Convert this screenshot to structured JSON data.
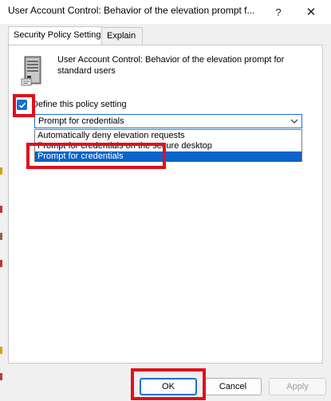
{
  "window": {
    "title": "User Account Control: Behavior of the elevation prompt f...",
    "help_glyph": "?",
    "close_glyph": "✕"
  },
  "tabs": [
    {
      "label": "Security Policy Setting",
      "active": true
    },
    {
      "label": "Explain",
      "active": false
    }
  ],
  "policy": {
    "icon": "server-tower-icon",
    "title": "User Account Control: Behavior of the elevation prompt for standard users"
  },
  "define_setting": {
    "label": "Define this policy setting",
    "checked": true
  },
  "combo": {
    "selected_value": "Prompt for credentials",
    "options": [
      {
        "label": "Automatically deny elevation requests",
        "selected": false
      },
      {
        "label": "Prompt for credentials on the secure desktop",
        "selected": false
      },
      {
        "label": "Prompt for credentials",
        "selected": true
      }
    ]
  },
  "buttons": {
    "ok": "OK",
    "cancel": "Cancel",
    "apply": "Apply"
  },
  "colors": {
    "accent": "#1b6fd1",
    "selection": "#0a64c8",
    "annotation_red": "#e0101a"
  }
}
